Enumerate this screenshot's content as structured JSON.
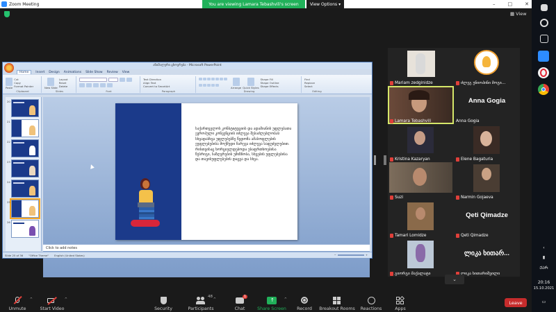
{
  "window": {
    "title": "Zoom Meeting",
    "share_banner": "You are viewing Lamara Tebashvili's screen",
    "view_options": "View Options",
    "view_label": "View"
  },
  "ppt": {
    "title": "ანიმალური ცხოვრება - Microsoft PowerPoint",
    "tabs": [
      "Home",
      "Insert",
      "Design",
      "Animations",
      "Slide Show",
      "Review",
      "View"
    ],
    "ribbon_groups": [
      "Clipboard",
      "Slides",
      "Font",
      "Paragraph",
      "Drawing",
      "Editing"
    ],
    "ribbon_items": {
      "paste": "Paste",
      "cut": "Cut",
      "copy": "Copy",
      "format_painter": "Format Painter",
      "new_slide": "New Slide",
      "layout": "Layout",
      "reset": "Reset",
      "delete": "Delete",
      "find": "Find",
      "replace": "Replace",
      "select": "Select",
      "arrange": "Arrange",
      "quick_styles": "Quick Styles",
      "text_direction": "Text Direction",
      "align_text": "Align Text",
      "convert_smartart": "Convert to SmartArt",
      "shape_fill": "Shape Fill",
      "shape_outline": "Shape Outline",
      "shape_effects": "Shape Effects"
    },
    "slide_numbers": [
      "20",
      "21",
      "22",
      "23",
      "24",
      "25",
      "26"
    ],
    "slide_text": "საქართველოს კონსტიტუციის და ადამიანის უფლებათა ევროპული კონვენციის იძლევა შესაძლებლობას სხვადასხვა უფლებებზე წვდომა ამასოფლების ეუფლებებისა მოქმედი ჩარევა იძლევა საფუძვლებით. რისთვისაც ხორციელდებოდა უსაფრთხოებისა წესრიგი, საზღვრების უმიზნობა, სხვების უფლებებისა და თავისუფლებების დაცვა და სხვა.",
    "notes_placeholder": "Click to add notes",
    "status": {
      "slide": "Slide 25 of 36",
      "theme": "\"Office Theme\"",
      "language": "English (United States)"
    }
  },
  "participants": [
    {
      "name": "Mariam zedginidze",
      "muted": true,
      "kind": "video"
    },
    {
      "name": "ძლეგ უნიოპინი მოგი...",
      "muted": true,
      "kind": "logo"
    },
    {
      "name": "Lamara Tebashvili",
      "muted": true,
      "kind": "video",
      "active": true
    },
    {
      "name": "Anna Gogia",
      "muted": false,
      "kind": "name",
      "big": "Anna Gogia"
    },
    {
      "name": "Kristina Kazaryan",
      "muted": true,
      "kind": "video"
    },
    {
      "name": "Elene Bagaturia",
      "muted": true,
      "kind": "video"
    },
    {
      "name": "Suzi",
      "muted": true,
      "kind": "video"
    },
    {
      "name": "Narmin Gojaeva",
      "muted": true,
      "kind": "video"
    },
    {
      "name": "Tamari Lomidze",
      "muted": true,
      "kind": "video"
    },
    {
      "name": "Qeti Qimadze",
      "muted": true,
      "kind": "name",
      "big": "Qeti Qimadze"
    },
    {
      "name": "გიორგი მაქალატი",
      "muted": true,
      "kind": "video"
    },
    {
      "name": "ლიკა ხითარიშვილი",
      "muted": true,
      "kind": "name",
      "big": "ლიკა ხითარ..."
    }
  ],
  "toolbar": {
    "unmute": "Unmute",
    "start_video": "Start Video",
    "security": "Security",
    "participants": "Participants",
    "participants_count": "48",
    "chat": "Chat",
    "chat_badge": "1",
    "share_screen": "Share Screen",
    "record": "Record",
    "breakout_rooms": "Breakout Rooms",
    "reactions": "Reactions",
    "apps": "Apps",
    "leave": "Leave"
  },
  "taskbar": {
    "time": "20:16",
    "date": "15.10.2021",
    "lang": "ᲥᲐᲠ"
  },
  "colors": {
    "share_green": "#21b15a",
    "active_speaker": "#d6e86a",
    "leave_red": "#c62c2c",
    "ppt_slide_blue": "#1b3a8a"
  }
}
